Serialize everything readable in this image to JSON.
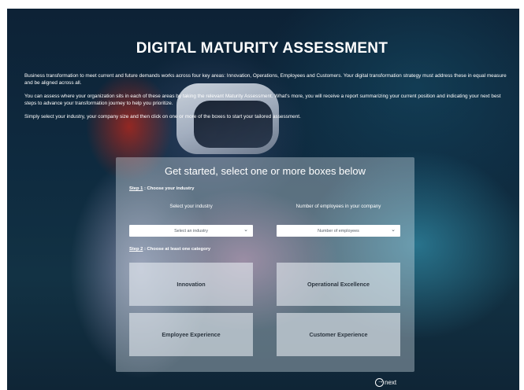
{
  "page": {
    "title": "DIGITAL MATURITY ASSESSMENT",
    "intro": [
      "Business transformation to meet current and future demands works across four key areas: Innovation, Operations, Employees and Customers. Your digital transformation strategy must address these in equal measure and be aligned across all.",
      "You can assess where your organization sits in each of these areas by taking the relevant Maturity Assessment. What's more, you will receive a report summarizing your current position and indicating your next best steps to advance your transformation journey to help you prioritize.",
      "Simply select your industry, your company size and then click on one or more of the boxes to start your tailored assessment."
    ]
  },
  "panel": {
    "title": "Get started, select one or more boxes below",
    "step1": {
      "num": "Step 1",
      "text": " : Choose your industry"
    },
    "industry_label": "Select your industry",
    "employees_label": "Number of employees in your company",
    "industry_select": "Select an industry",
    "employees_select": "Number of employees",
    "step2": {
      "num": "Step 2",
      "text": " : Choose at least one category"
    },
    "categories": [
      "Innovation",
      "Operational Excellence",
      "Employee Experience",
      "Customer Experience"
    ]
  },
  "footer": {
    "next_label": "next"
  },
  "icons": {
    "dropdown": "chevron-down-icon",
    "next": "arrow-circle-icon"
  },
  "colors": {
    "panel": "#d7e2eb",
    "text": "#ffffff",
    "background": "#0e2a3f"
  }
}
